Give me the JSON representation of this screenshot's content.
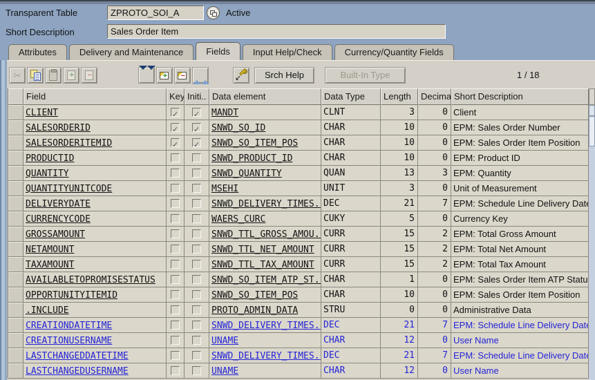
{
  "header": {
    "table_type_label": "Transparent Table",
    "table_name": "ZPROTO_SOI_A",
    "status": "Active",
    "short_description_label": "Short Description",
    "short_description_value": "Sales Order Item"
  },
  "tabs": [
    {
      "label": "Attributes",
      "active": false
    },
    {
      "label": "Delivery and Maintenance",
      "active": false
    },
    {
      "label": "Fields",
      "active": true
    },
    {
      "label": "Input Help/Check",
      "active": false
    },
    {
      "label": "Currency/Quantity Fields",
      "active": false
    }
  ],
  "toolbar": {
    "icons": [
      "cut-icon",
      "copy-icon",
      "paste-icon",
      "insert-row-icon",
      "delete-row-icon",
      "double-arrow-down-icon",
      "insert-box-icon",
      "delete-box-icon",
      "double-arrow-up-icon",
      "search-help-key-icon"
    ],
    "srch_help_label": "Srch Help",
    "built_in_type_label": "Built-In Type",
    "position_indicator": "1 / 18"
  },
  "table": {
    "columns": [
      "Field",
      "Key",
      "Initi..",
      "Data element",
      "Data Type",
      "Length",
      "Decima..",
      "Short Description"
    ],
    "rows": [
      {
        "field": "CLIENT",
        "key": true,
        "initial": true,
        "data_element": "MANDT",
        "data_type": "CLNT",
        "length": "3",
        "decimals": "0",
        "short_description": "Client",
        "blue": false
      },
      {
        "field": "SALESORDERID",
        "key": true,
        "initial": true,
        "data_element": "SNWD_SO_ID",
        "data_type": "CHAR",
        "length": "10",
        "decimals": "0",
        "short_description": "EPM: Sales Order Number",
        "blue": false
      },
      {
        "field": "SALESORDERITEMID",
        "key": true,
        "initial": true,
        "data_element": "SNWD_SO_ITEM_POS",
        "data_type": "CHAR",
        "length": "10",
        "decimals": "0",
        "short_description": "EPM: Sales Order Item Position",
        "blue": false
      },
      {
        "field": "PRODUCTID",
        "key": false,
        "initial": false,
        "data_element": "SNWD_PRODUCT_ID",
        "data_type": "CHAR",
        "length": "10",
        "decimals": "0",
        "short_description": "EPM: Product ID",
        "blue": false
      },
      {
        "field": "QUANTITY",
        "key": false,
        "initial": false,
        "data_element": "SNWD_QUANTITY",
        "data_type": "QUAN",
        "length": "13",
        "decimals": "3",
        "short_description": "EPM: Quantity",
        "blue": false
      },
      {
        "field": "QUANTITYUNITCODE",
        "key": false,
        "initial": false,
        "data_element": "MSEHI",
        "data_type": "UNIT",
        "length": "3",
        "decimals": "0",
        "short_description": "Unit of Measurement",
        "blue": false
      },
      {
        "field": "DELIVERYDATE",
        "key": false,
        "initial": false,
        "data_element": "SNWD_DELIVERY_TIMES..",
        "data_type": "DEC",
        "length": "21",
        "decimals": "7",
        "short_description": "EPM: Schedule Line Delivery Date",
        "blue": false
      },
      {
        "field": "CURRENCYCODE",
        "key": false,
        "initial": false,
        "data_element": "WAERS_CURC",
        "data_type": "CUKY",
        "length": "5",
        "decimals": "0",
        "short_description": "Currency Key",
        "blue": false
      },
      {
        "field": "GROSSAMOUNT",
        "key": false,
        "initial": false,
        "data_element": "SNWD_TTL_GROSS_AMOU..",
        "data_type": "CURR",
        "length": "15",
        "decimals": "2",
        "short_description": "EPM: Total Gross Amount",
        "blue": false
      },
      {
        "field": "NETAMOUNT",
        "key": false,
        "initial": false,
        "data_element": "SNWD_TTL_NET_AMOUNT",
        "data_type": "CURR",
        "length": "15",
        "decimals": "2",
        "short_description": "EPM: Total Net Amount",
        "blue": false
      },
      {
        "field": "TAXAMOUNT",
        "key": false,
        "initial": false,
        "data_element": "SNWD_TTL_TAX_AMOUNT",
        "data_type": "CURR",
        "length": "15",
        "decimals": "2",
        "short_description": "EPM: Total Tax Amount",
        "blue": false
      },
      {
        "field": "AVAILABLETOPROMISESTATUS",
        "key": false,
        "initial": false,
        "data_element": "SNWD_SO_ITEM_ATP_ST..",
        "data_type": "CHAR",
        "length": "1",
        "decimals": "0",
        "short_description": "EPM: Sales Order Item ATP Status",
        "blue": false
      },
      {
        "field": "OPPORTUNITYITEMID",
        "key": false,
        "initial": false,
        "data_element": "SNWD_SO_ITEM_POS",
        "data_type": "CHAR",
        "length": "10",
        "decimals": "0",
        "short_description": "EPM: Sales Order Item Position",
        "blue": false
      },
      {
        "field": ".INCLUDE",
        "key": false,
        "initial": false,
        "data_element": "PROTO_ADMIN_DATA",
        "data_type": "STRU",
        "length": "0",
        "decimals": "0",
        "short_description": "Administrative Data",
        "blue": false
      },
      {
        "field": "CREATIONDATETIME",
        "key": false,
        "initial": false,
        "data_element": "SNWD_DELIVERY_TIMES..",
        "data_type": "DEC",
        "length": "21",
        "decimals": "7",
        "short_description": "EPM: Schedule Line Delivery Date",
        "blue": true
      },
      {
        "field": "CREATIONUSERNAME",
        "key": false,
        "initial": false,
        "data_element": "UNAME",
        "data_type": "CHAR",
        "length": "12",
        "decimals": "0",
        "short_description": "User Name",
        "blue": true
      },
      {
        "field": "LASTCHANGEDDATETIME",
        "key": false,
        "initial": false,
        "data_element": "SNWD_DELIVERY_TIMES..",
        "data_type": "DEC",
        "length": "21",
        "decimals": "7",
        "short_description": "EPM: Schedule Line Delivery Date",
        "blue": true
      },
      {
        "field": "LASTCHANGEDUSERNAME",
        "key": false,
        "initial": false,
        "data_element": "UNAME",
        "data_type": "CHAR",
        "length": "12",
        "decimals": "0",
        "short_description": "User Name",
        "blue": true
      }
    ]
  },
  "colors": {
    "header_blue": "#8EA4C1",
    "panel_gray": "#D4D0C8",
    "row_beige": "#DBD7CB",
    "link_blue": "#2424D6"
  }
}
